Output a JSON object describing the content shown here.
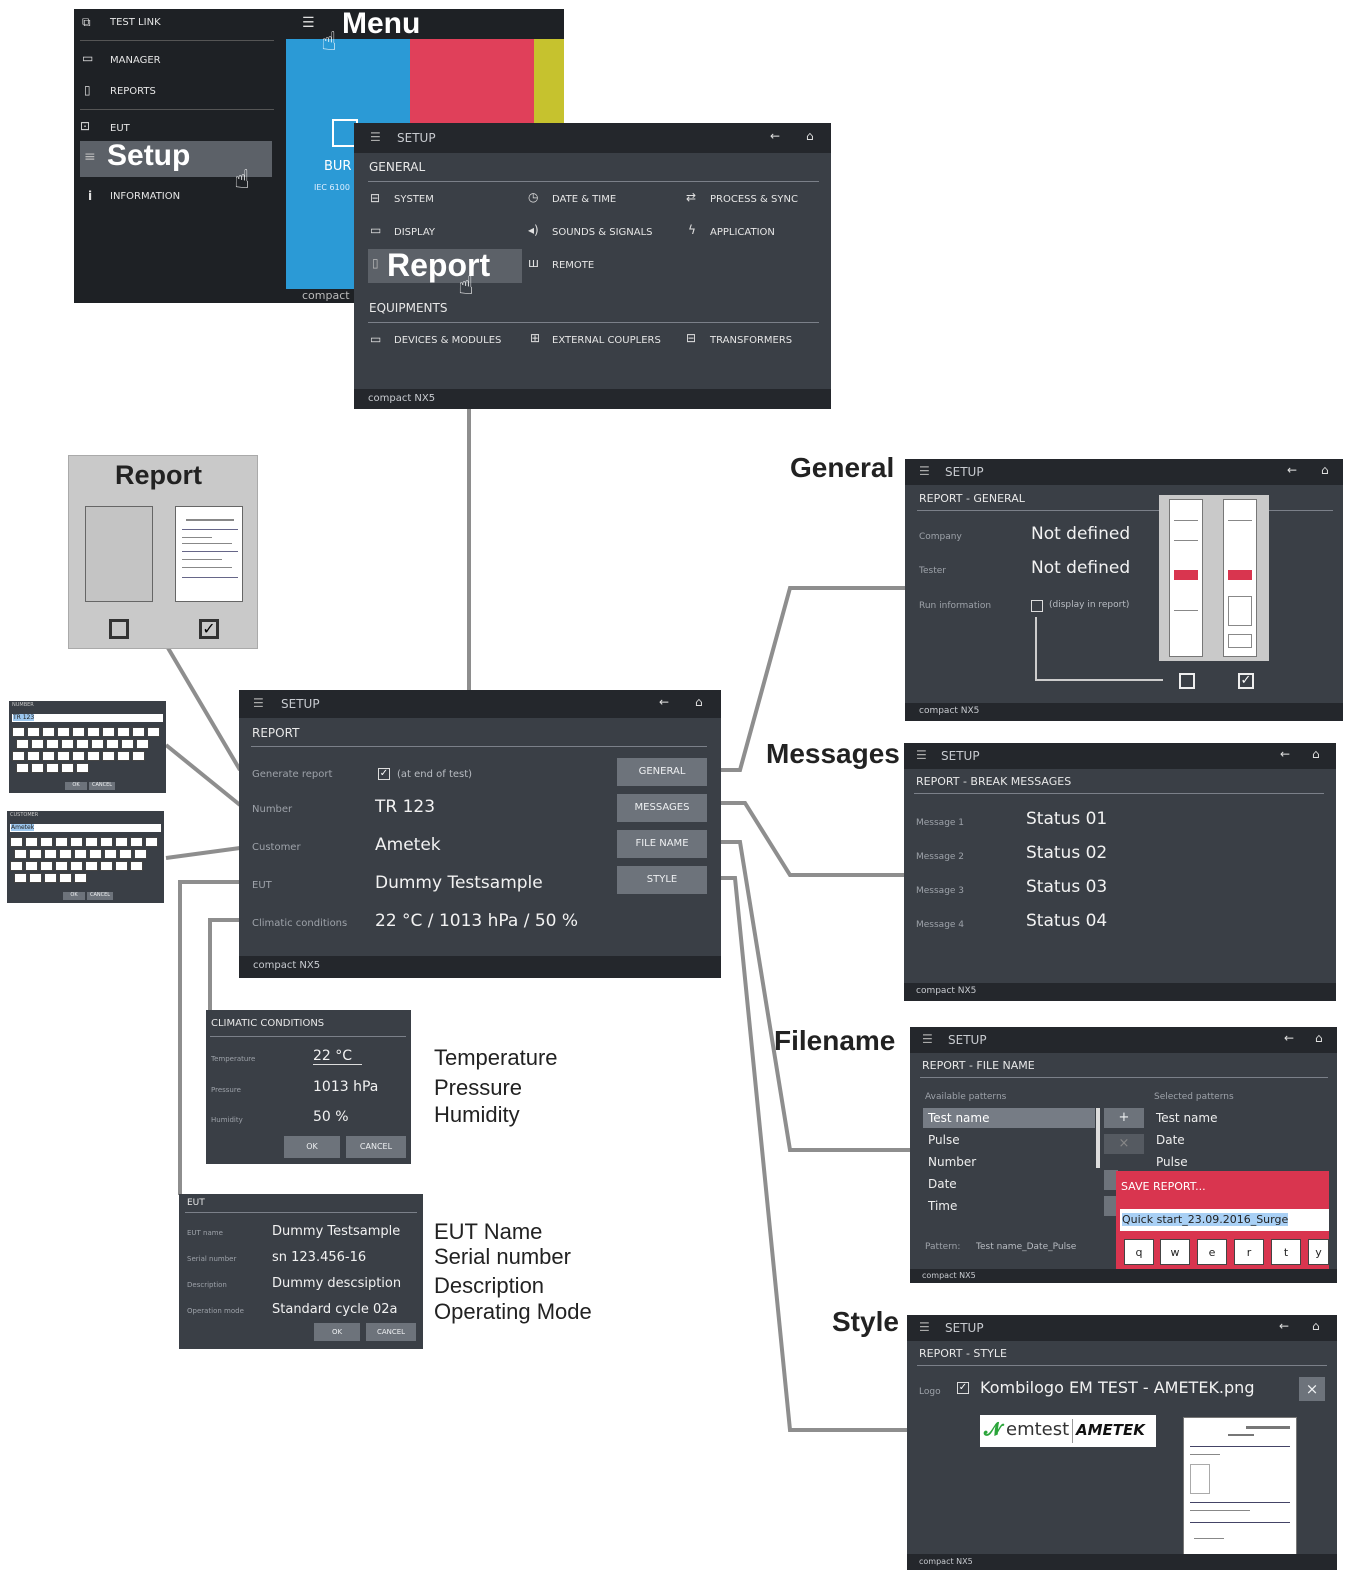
{
  "menu": {
    "title": "Menu",
    "items": [
      {
        "label": "TEST LINK",
        "icon": "windows-icon"
      },
      {
        "label": "MANAGER",
        "icon": "folder-icon"
      },
      {
        "label": "REPORTS",
        "icon": "document-icon"
      },
      {
        "label": "EUT",
        "icon": "eut-icon"
      },
      {
        "label": "Setup",
        "icon": "sliders-icon"
      },
      {
        "label": "INFORMATION",
        "icon": "info-icon"
      }
    ],
    "tile_text": "BUR",
    "tile_sub": "IEC 6100",
    "footer": "compact N"
  },
  "setup_main": {
    "title": "SETUP",
    "general_heading": "GENERAL",
    "general_items": [
      {
        "label": "SYSTEM",
        "icon": "system-icon"
      },
      {
        "label": "DATE & TIME",
        "icon": "clock-icon"
      },
      {
        "label": "PROCESS & SYNC",
        "icon": "sync-icon"
      },
      {
        "label": "DISPLAY",
        "icon": "monitor-icon"
      },
      {
        "label": "SOUNDS & SIGNALS",
        "icon": "speaker-icon"
      },
      {
        "label": "APPLICATION",
        "icon": "bolt-icon"
      },
      {
        "label": "Report",
        "icon": "report-icon"
      },
      {
        "label": "REMOTE",
        "icon": "remote-icon"
      }
    ],
    "equipments_heading": "EQUIPMENTS",
    "equipment_items": [
      {
        "label": "DEVICES & MODULES",
        "icon": "module-icon"
      },
      {
        "label": "EXTERNAL COUPLERS",
        "icon": "coupler-icon"
      },
      {
        "label": "TRANSFORMERS",
        "icon": "transformer-icon"
      }
    ],
    "footer": "compact NX5"
  },
  "report_thumb": {
    "title": "Report"
  },
  "report_setup": {
    "title": "SETUP",
    "heading": "REPORT",
    "rows": [
      {
        "label": "Generate report",
        "value": "(at end of test)"
      },
      {
        "label": "Number",
        "value": "TR 123"
      },
      {
        "label": "Customer",
        "value": "Ametek"
      },
      {
        "label": "EUT",
        "value": "Dummy Testsample"
      },
      {
        "label": "Climatic conditions",
        "value": "22 °C / 1013 hPa / 50 %"
      }
    ],
    "buttons": [
      "GENERAL",
      "MESSAGES",
      "FILE NAME",
      "STYLE"
    ],
    "footer": "compact NX5"
  },
  "kbd_number": {
    "title": "NUMBER",
    "value": "TR 123",
    "ok": "OK",
    "cancel": "CANCEL"
  },
  "kbd_customer": {
    "title": "CUSTOMER",
    "value": "Ametek",
    "ok": "OK",
    "cancel": "CANCEL"
  },
  "climatic": {
    "heading": "CLIMATIC CONDITIONS",
    "rows": [
      {
        "label": "Temperature",
        "value": "22 °C"
      },
      {
        "label": "Pressure",
        "value": "1013 hPa"
      },
      {
        "label": "Humidity",
        "value": "50 %"
      }
    ],
    "ok": "OK",
    "cancel": "CANCEL",
    "captions": [
      "Temperature",
      "Pressure",
      "Humidity"
    ]
  },
  "eut": {
    "heading": "EUT",
    "rows": [
      {
        "label": "EUT name",
        "value": "Dummy Testsample"
      },
      {
        "label": "Serial number",
        "value": "sn 123.456-16"
      },
      {
        "label": "Description",
        "value": "Dummy descsiption"
      },
      {
        "label": "Operation mode",
        "value": "Standard cycle 02a"
      }
    ],
    "ok": "OK",
    "cancel": "CANCEL",
    "captions": [
      "EUT Name",
      "Serial number",
      "Description",
      "Operating Mode"
    ]
  },
  "general": {
    "caption": "General",
    "title": "SETUP",
    "heading": "REPORT - GENERAL",
    "rows": [
      {
        "label": "Company",
        "value": "Not defined"
      },
      {
        "label": "Tester",
        "value": "Not defined"
      },
      {
        "label": "Run information",
        "value": "(display in report)"
      }
    ],
    "footer": "compact NX5"
  },
  "messages": {
    "caption": "Messages",
    "title": "SETUP",
    "heading": "REPORT - BREAK MESSAGES",
    "rows": [
      {
        "label": "Message 1",
        "value": "Status 01"
      },
      {
        "label": "Message 2",
        "value": "Status 02"
      },
      {
        "label": "Message 3",
        "value": "Status 03"
      },
      {
        "label": "Message 4",
        "value": "Status 04"
      }
    ],
    "footer": "compact NX5"
  },
  "filename": {
    "caption": "Filename",
    "title": "SETUP",
    "heading": "REPORT - FILE NAME",
    "available_label": "Available patterns",
    "selected_label": "Selected patterns",
    "available": [
      "Test name",
      "Pulse",
      "Number",
      "Date",
      "Time"
    ],
    "selected": [
      "Test name",
      "Date",
      "Pulse"
    ],
    "pattern_label": "Pattern:",
    "pattern_value": "Test name_Date_Pulse",
    "save_title": "SAVE REPORT...",
    "save_value": "Quick start_23.09.2016_Surge",
    "keys": [
      "q",
      "w",
      "e",
      "r",
      "t",
      "y"
    ],
    "plus": "+",
    "times": "×",
    "footer": "compact NX5"
  },
  "style": {
    "caption": "Style",
    "title": "SETUP",
    "heading": "REPORT - STYLE",
    "logo_label": "Logo",
    "logo_value": "Kombilogo EM TEST - AMETEK.png",
    "logo_em": "emtest",
    "logo_ametek": "AMETEK",
    "close": "×",
    "footer": "compact NX5"
  },
  "colors": {
    "panel": "#3a3f46",
    "header": "#24272c",
    "accent_red": "#d9354f",
    "tile_blue": "#2b9ad6",
    "tile_red": "#e0405a",
    "tile_yellow": "#c6c22e"
  }
}
